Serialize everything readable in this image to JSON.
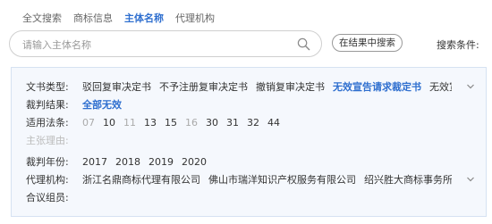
{
  "tabs": [
    {
      "label": "全文搜索",
      "active": false
    },
    {
      "label": "商标信息",
      "active": false
    },
    {
      "label": "主体名称",
      "active": true
    },
    {
      "label": "代理机构",
      "active": false
    }
  ],
  "search": {
    "placeholder": "请输入主体名称",
    "value": ""
  },
  "within_results_label": "在结果中搜索",
  "conditions_label": "搜索条件:",
  "filters": {
    "doc_type": {
      "label": "文书类型:",
      "options": [
        {
          "text": "驳回复审决定书",
          "state": "normal"
        },
        {
          "text": "不予注册复审决定书",
          "state": "normal"
        },
        {
          "text": "撤销复审决定书",
          "state": "normal"
        },
        {
          "text": "无效宣告请求裁定书",
          "state": "selected"
        },
        {
          "text": "无效宣告",
          "state": "normal"
        }
      ]
    },
    "result": {
      "label": "裁判结果:",
      "options": [
        {
          "text": "全部无效",
          "state": "selected"
        }
      ]
    },
    "law": {
      "label": "适用法条:",
      "options": [
        {
          "text": "07",
          "state": "muted"
        },
        {
          "text": "10",
          "state": "normal"
        },
        {
          "text": "11",
          "state": "muted"
        },
        {
          "text": "13",
          "state": "normal"
        },
        {
          "text": "15",
          "state": "normal"
        },
        {
          "text": "16",
          "state": "muted"
        },
        {
          "text": "30",
          "state": "normal"
        },
        {
          "text": "31",
          "state": "normal"
        },
        {
          "text": "32",
          "state": "normal"
        },
        {
          "text": "44",
          "state": "normal"
        }
      ]
    },
    "reason": {
      "label": "主张理由:",
      "options": []
    },
    "year": {
      "label": "裁判年份:",
      "options": [
        {
          "text": "2017",
          "state": "normal"
        },
        {
          "text": "2018",
          "state": "normal"
        },
        {
          "text": "2019",
          "state": "normal"
        },
        {
          "text": "2020",
          "state": "normal"
        }
      ]
    },
    "agency": {
      "label": "代理机构:",
      "options": [
        {
          "text": "浙江名鼎商标代理有限公司",
          "state": "normal"
        },
        {
          "text": "佛山市瑞洋知识产权服务有限公司",
          "state": "normal"
        },
        {
          "text": "绍兴胜大商标事务所有限公司",
          "state": "normal"
        }
      ]
    },
    "panel": {
      "label": "合议组员:",
      "options": []
    }
  },
  "colors": {
    "accent": "#2f6fcf",
    "panel_bg": "#f5f8fd",
    "panel_border": "#d6e2f2"
  }
}
